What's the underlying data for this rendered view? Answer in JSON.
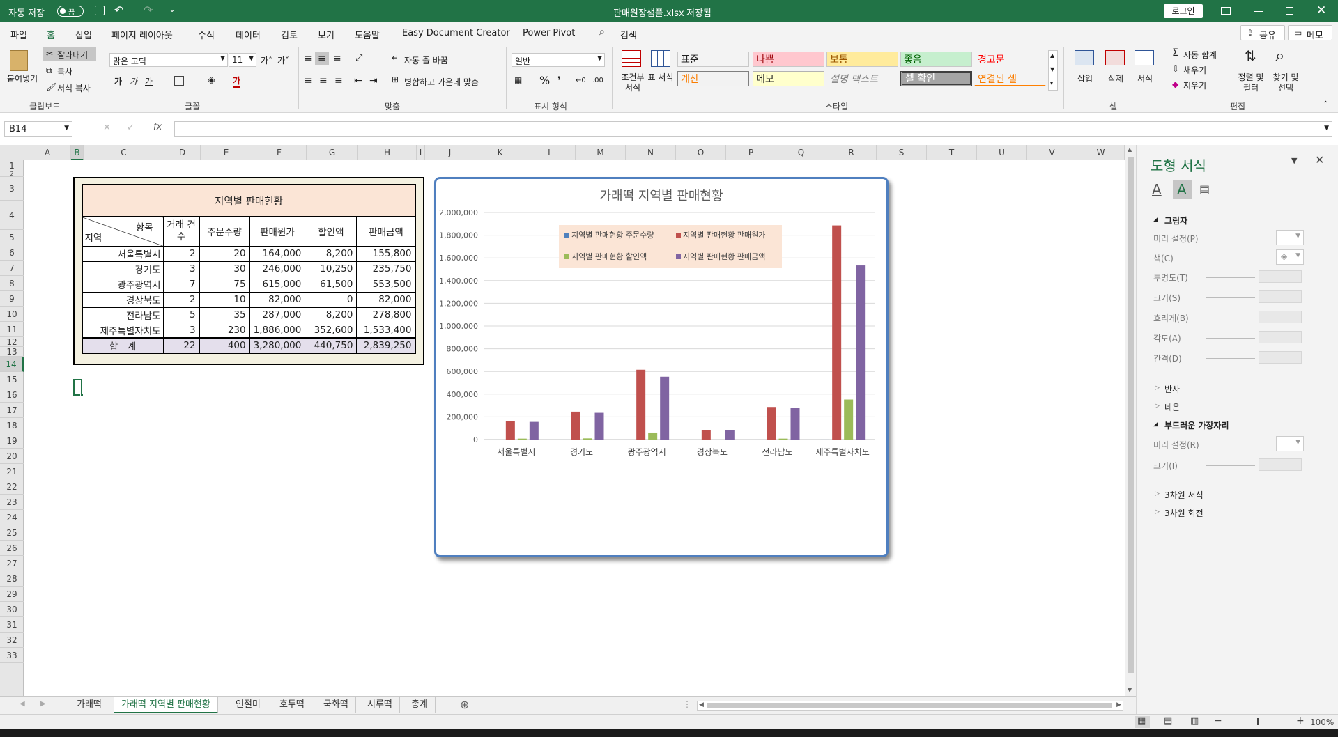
{
  "titlebar": {
    "autosave_label": "자동 저장",
    "autosave_state": "끔",
    "filename": "판매원장샘플.xlsx",
    "save_status": "저장됨",
    "login_button": "로그인"
  },
  "menu": {
    "items": [
      "파일",
      "홈",
      "삽입",
      "페이지 레이아웃",
      "수식",
      "데이터",
      "검토",
      "보기",
      "도움말",
      "Easy Document Creator",
      "Power Pivot"
    ],
    "active": "홈",
    "search_label": "검색",
    "share_label": "공유",
    "memo_label": "메모"
  },
  "ribbon": {
    "clipboard": {
      "paste": "붙여넣기",
      "cut": "잘라내기",
      "copy": "복사",
      "format_painter": "서식 복사",
      "group": "클립보드"
    },
    "font": {
      "name": "맑은 고딕",
      "size": "11",
      "group": "글꼴",
      "bold": "가",
      "italic": "가",
      "underline": "가",
      "font_color_glyph": "가"
    },
    "alignment": {
      "wrap": "자동 줄 바꿈",
      "merge": "병합하고 가운데 맞춤",
      "group": "맞춤"
    },
    "number": {
      "format": "일반",
      "group": "표시 형식"
    },
    "styles": {
      "conditional": "조건부 서식",
      "table": "표 서식",
      "cells": [
        {
          "label": "표준",
          "bg": "#ffffff",
          "fg": "#000000"
        },
        {
          "label": "나쁨",
          "bg": "#ffc7ce",
          "fg": "#9c0006"
        },
        {
          "label": "보통",
          "bg": "#ffeb9c",
          "fg": "#9c5700"
        },
        {
          "label": "좋음",
          "bg": "#c6efce",
          "fg": "#006100"
        },
        {
          "label": "경고문",
          "bg": "#ffffff",
          "fg": "#ff0000"
        },
        {
          "label": "계산",
          "bg": "#f2f2f2",
          "fg": "#fa7d00"
        },
        {
          "label": "메모",
          "bg": "#ffffcc",
          "fg": "#000000"
        },
        {
          "label": "설명 텍스트",
          "bg": "#ffffff",
          "fg": "#7f7f7f"
        },
        {
          "label": "셀 확인",
          "bg": "#a5a5a5",
          "fg": "#ffffff"
        },
        {
          "label": "연결된 셀",
          "bg": "#ffffff",
          "fg": "#fa7d00"
        }
      ],
      "group": "스타일"
    },
    "cells": {
      "insert": "삽입",
      "delete": "삭제",
      "format": "서식",
      "group": "셀"
    },
    "editing": {
      "autosum": "자동 합계",
      "fill": "채우기",
      "clear": "지우기",
      "sort": "정렬 및 필터",
      "find": "찾기 및 선택",
      "group": "편집"
    }
  },
  "formula_bar": {
    "name_box": "B14",
    "formula": ""
  },
  "columns": [
    "A",
    "B",
    "C",
    "D",
    "E",
    "F",
    "G",
    "H",
    "I",
    "J",
    "K",
    "L",
    "M",
    "N",
    "O",
    "P",
    "Q",
    "R",
    "S",
    "T",
    "U",
    "V",
    "W"
  ],
  "rows": [
    "1",
    "2",
    "3",
    "4",
    "5",
    "6",
    "7",
    "8",
    "9",
    "10",
    "11",
    "12",
    "13",
    "14",
    "15",
    "16",
    "17",
    "18",
    "19",
    "20",
    "21",
    "22",
    "23",
    "24",
    "25",
    "26",
    "27",
    "28",
    "29",
    "30",
    "31",
    "32",
    "33"
  ],
  "table": {
    "title": "지역별 판매현황",
    "corner_top": "항목",
    "corner_bottom": "지역",
    "headers": [
      "거래 건수",
      "주문수량",
      "판매원가",
      "할인액",
      "판매금액"
    ],
    "rows": [
      [
        "서울특별시",
        "2",
        "20",
        "164,000",
        "8,200",
        "155,800"
      ],
      [
        "경기도",
        "3",
        "30",
        "246,000",
        "10,250",
        "235,750"
      ],
      [
        "광주광역시",
        "7",
        "75",
        "615,000",
        "61,500",
        "553,500"
      ],
      [
        "경상북도",
        "2",
        "10",
        "82,000",
        "0",
        "82,000"
      ],
      [
        "전라남도",
        "5",
        "35",
        "287,000",
        "8,200",
        "278,800"
      ],
      [
        "제주특별자치도",
        "3",
        "230",
        "1,886,000",
        "352,600",
        "1,533,400"
      ]
    ],
    "total": [
      "합　계",
      "22",
      "400",
      "3,280,000",
      "440,750",
      "2,839,250"
    ]
  },
  "chart_data": {
    "type": "bar",
    "title": "가래떡 지역별 판매현황",
    "categories": [
      "서울특별시",
      "경기도",
      "광주광역시",
      "경상북도",
      "전라남도",
      "제주특별자치도"
    ],
    "series": [
      {
        "name": "지역별 판매현황 주문수량",
        "color": "#4f81bd",
        "values": [
          20,
          30,
          75,
          10,
          35,
          230
        ]
      },
      {
        "name": "지역별 판매현황 판매원가",
        "color": "#c0504d",
        "values": [
          164000,
          246000,
          615000,
          82000,
          287000,
          1886000
        ]
      },
      {
        "name": "지역별 판매현황 할인액",
        "color": "#9bbb59",
        "values": [
          8200,
          10250,
          61500,
          0,
          8200,
          352600
        ]
      },
      {
        "name": "지역별 판매현황 판매금액",
        "color": "#8064a2",
        "values": [
          155800,
          235750,
          553500,
          82000,
          278800,
          1533400
        ]
      }
    ],
    "ylim": [
      0,
      2000000
    ],
    "yticks": [
      "0",
      "200,000",
      "400,000",
      "600,000",
      "800,000",
      "1,000,000",
      "1,200,000",
      "1,400,000",
      "1,600,000",
      "1,800,000",
      "2,000,000"
    ],
    "grid": true,
    "legend": "top-center"
  },
  "pane": {
    "title": "도형 서식",
    "shadow": "그림자",
    "preset": "미리 설정(P)",
    "color": "색(C)",
    "transparency": "투명도(T)",
    "size": "크기(S)",
    "blur": "흐리게(B)",
    "angle": "각도(A)",
    "distance": "간격(D)",
    "reflection": "반사",
    "glow": "네온",
    "soft_edges": "부드러운 가장자리",
    "soft_preset": "미리 설정(R)",
    "soft_size": "크기(I)",
    "format3d": "3차원 서식",
    "rotation3d": "3차원 회전"
  },
  "sheets": {
    "tabs": [
      "가래떡",
      "가래떡 지역별 판매현황",
      "인절미",
      "호두떡",
      "국화떡",
      "시루떡",
      "총계"
    ],
    "active": "가래떡 지역별 판매현황"
  },
  "status": {
    "zoom": "100%"
  }
}
